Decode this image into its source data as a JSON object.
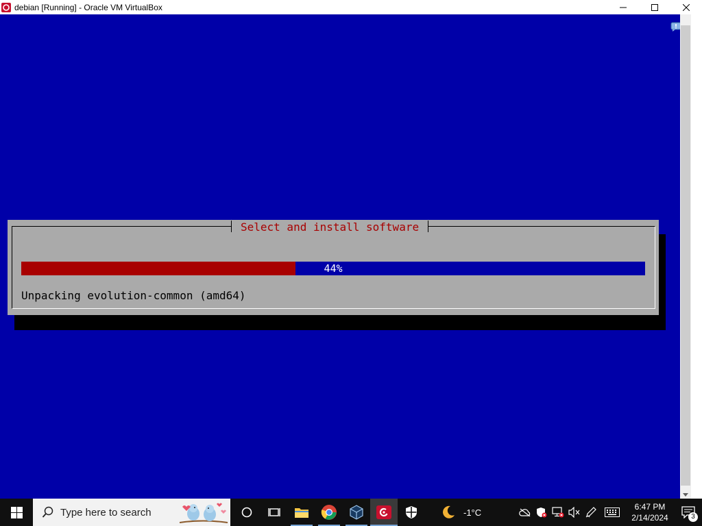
{
  "window": {
    "title": "debian [Running] - Oracle VM VirtualBox",
    "controls": {
      "minimize_icon": "minimize-icon",
      "maximize_icon": "maximize-icon",
      "close_icon": "close-icon"
    }
  },
  "installer": {
    "dialog_title": "Select and install software",
    "progress_percent": 44,
    "progress_label": "44%",
    "status": "Unpacking evolution-common (amd64)",
    "colors": {
      "screen_bg": "#0000a8",
      "dialog_bg": "#aaaaaa",
      "title_fg": "#a80000",
      "progress_fill": "#a80000",
      "progress_bg": "#0000a8"
    }
  },
  "taskbar": {
    "search_placeholder": "Type here to search",
    "apps": [
      {
        "name": "cortana",
        "icon": "circle-icon"
      },
      {
        "name": "task-view",
        "icon": "task-view-icon"
      },
      {
        "name": "file-explorer",
        "icon": "folder-icon"
      },
      {
        "name": "chrome",
        "icon": "chrome-icon"
      },
      {
        "name": "virtualbox",
        "icon": "virtualbox-icon"
      },
      {
        "name": "debian-vm",
        "icon": "debian-icon"
      },
      {
        "name": "security",
        "icon": "shield-icon"
      }
    ],
    "weather": {
      "icon": "moon-icon",
      "temperature": "-1°C"
    },
    "clock": {
      "time": "6:47 PM",
      "date": "2/14/2024"
    },
    "notifications": {
      "count": "3"
    }
  }
}
